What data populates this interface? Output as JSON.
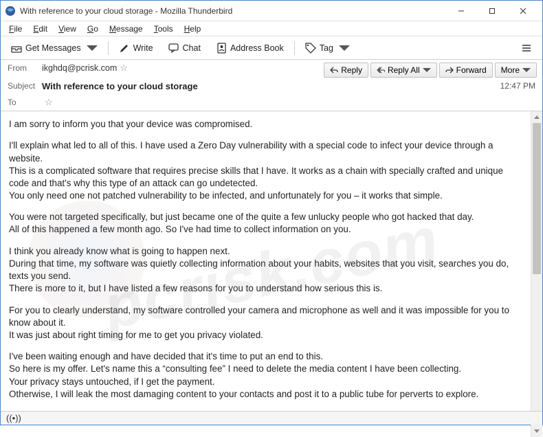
{
  "window": {
    "title": "With reference to your cloud storage - Mozilla Thunderbird"
  },
  "menu": {
    "file": "File",
    "edit": "Edit",
    "view": "View",
    "go": "Go",
    "message": "Message",
    "tools": "Tools",
    "help": "Help"
  },
  "toolbar": {
    "get_messages": "Get Messages",
    "write": "Write",
    "chat": "Chat",
    "address_book": "Address Book",
    "tag": "Tag"
  },
  "actions": {
    "reply": "Reply",
    "reply_all": "Reply All",
    "forward": "Forward",
    "more": "More"
  },
  "header": {
    "from_label": "From",
    "from_value": "ikghdq@pcrisk.com",
    "subject_label": "Subject",
    "subject_value": "With reference to your cloud storage",
    "to_label": "To",
    "time": "12:47 PM"
  },
  "body": {
    "p1": "I am sorry to inform you that your device was compromised.",
    "p2a": "I'll explain what led to all of this. I have used a Zero Day vulnerability with a special code to infect your device through a website.",
    "p2b": "This is a complicated software that requires precise skills that I have. It works as a chain with specially crafted and unique code and that's why this type of an attack can go undetected.",
    "p2c": "You only need one not patched vulnerability to be infected, and unfortunately for you – it works that simple.",
    "p3a": "You were not targeted specifically, but just became one of the quite a few unlucky people who got hacked that day.",
    "p3b": "All of this happened a few month ago. So I've had time to collect information on you.",
    "p4a": "I think you already know what is going to happen next.",
    "p4b": "During that time, my software was quietly collecting information about your habits, websites that you visit, searches you do, texts you send.",
    "p4c": "There is more to it, but I have listed a few reasons for you to understand how serious this is.",
    "p5a": "For you to clearly understand, my software controlled your camera and microphone as well and it was impossible for you to know about it.",
    "p5b": "It was just about right timing for me to get you privacy violated.",
    "p6a": "I've been waiting enough and have decided that it's time to put an end to this.",
    "p6b": "So here is my offer. Let's name this a “consulting fee” I need to delete the media content I have been collecting.",
    "p6c": "Your privacy stays untouched, if I get the payment.",
    "p6d": "Otherwise, I will leak the most damaging content to your contacts and post it to a public tube for perverts to explore."
  },
  "watermark": "pcrisk.com"
}
